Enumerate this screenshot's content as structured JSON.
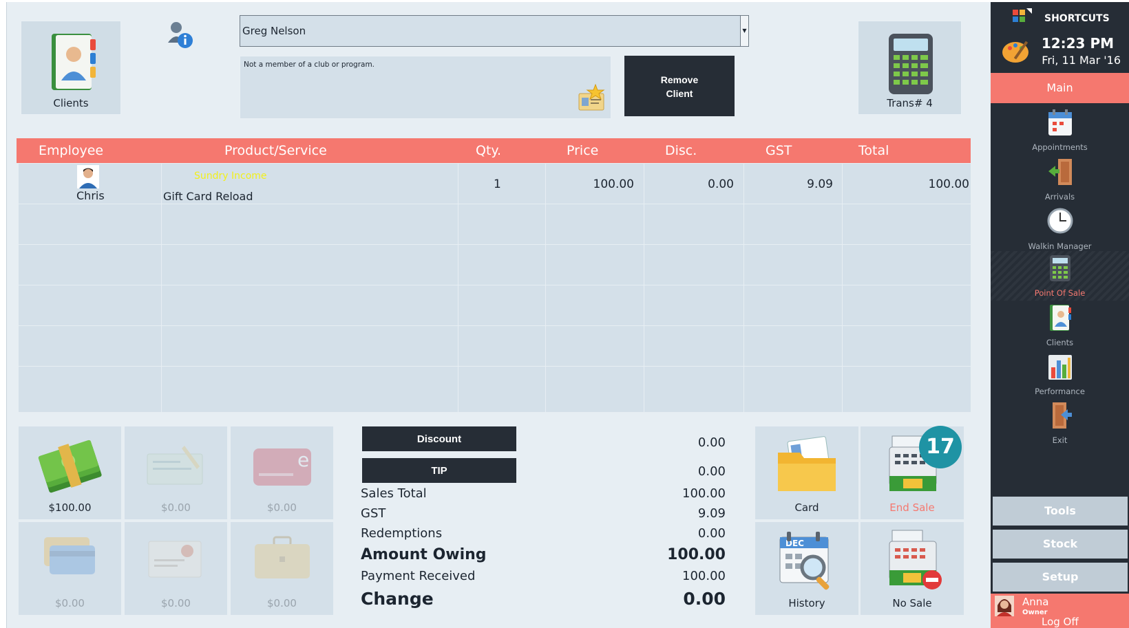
{
  "client": {
    "tile_label": "Clients",
    "selected_name": "Greg Nelson",
    "membership_text": "Not a member of a club or program.",
    "remove_line1": "Remove",
    "remove_line2": "Client"
  },
  "transaction": {
    "label": "Trans#  4"
  },
  "table": {
    "headers": [
      "Employee",
      "Product/Service",
      "Qty.",
      "Price",
      "Disc.",
      "GST",
      "Total"
    ],
    "rows": [
      {
        "employee": "Chris",
        "category": "Sundry Income",
        "product": "Gift Card Reload",
        "qty": "1",
        "price": "100.00",
        "disc": "0.00",
        "gst": "9.09",
        "total": "100.00"
      }
    ]
  },
  "payments": [
    {
      "amount": "$100.00",
      "icon": "cash-icon",
      "enabled": true
    },
    {
      "amount": "$0.00",
      "icon": "cheque-icon",
      "enabled": false
    },
    {
      "amount": "$0.00",
      "icon": "eftpos-card-icon",
      "enabled": false
    },
    {
      "amount": "$0.00",
      "icon": "credit-cards-icon",
      "enabled": false
    },
    {
      "amount": "$0.00",
      "icon": "gift-voucher-icon",
      "enabled": false
    },
    {
      "amount": "$0.00",
      "icon": "account-briefcase-icon",
      "enabled": false
    }
  ],
  "totals": {
    "discount_label": "Discount",
    "discount_value": "0.00",
    "tip_label": "TIP",
    "tip_value": "0.00",
    "sales_total_label": "Sales Total",
    "sales_total_value": "100.00",
    "gst_label": "GST",
    "gst_value": "9.09",
    "redemptions_label": "Redemptions",
    "redemptions_value": "0.00",
    "amount_owing_label": "Amount Owing",
    "amount_owing_value": "100.00",
    "payment_received_label": "Payment Received",
    "payment_received_value": "100.00",
    "change_label": "Change",
    "change_value": "0.00"
  },
  "actions": {
    "card": "Card",
    "end_sale": "End Sale",
    "history": "History",
    "no_sale": "No Sale",
    "badge": "17"
  },
  "sidebar": {
    "shortcuts": "SHORTCUTS",
    "time": "12:23 PM",
    "date": "Fri, 11 Mar '16",
    "main": "Main",
    "items": [
      {
        "label": "Appointments",
        "icon": "calendar-icon"
      },
      {
        "label": "Arrivals",
        "icon": "arrivals-door-icon"
      },
      {
        "label": "Walkin Manager",
        "icon": "clock-icon"
      },
      {
        "label": "Point Of Sale",
        "icon": "calculator-icon"
      },
      {
        "label": "Clients",
        "icon": "address-book-icon"
      },
      {
        "label": "Performance",
        "icon": "bar-chart-icon"
      },
      {
        "label": "Exit",
        "icon": "exit-door-icon"
      }
    ],
    "tools": "Tools",
    "stock": "Stock",
    "setup": "Setup",
    "user_name": "Anna",
    "user_role": "Owner",
    "logoff": "Log Off"
  },
  "colors": {
    "accent": "#f5786f",
    "dark": "#262d36",
    "panel": "#d4e0e9",
    "category_text": "#f2f01a",
    "badge": "#1f93a4"
  }
}
